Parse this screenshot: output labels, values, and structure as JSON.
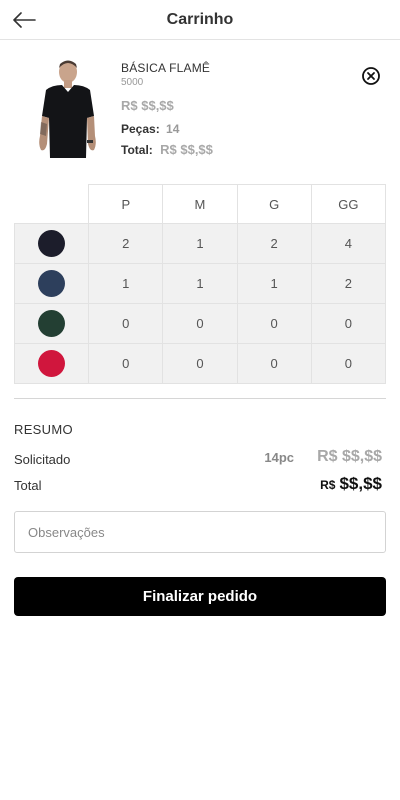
{
  "header": {
    "title": "Carrinho",
    "back_icon": "arrow-left-icon"
  },
  "product": {
    "name": "BÁSICA FLAMÊ",
    "code": "5000",
    "price": "R$ $$,$$",
    "qty_label": "Peças:",
    "qty_value": "14",
    "total_label": "Total:",
    "total_value": "R$ $$,$$",
    "remove_icon": "close-circle-icon"
  },
  "grid": {
    "sizes": [
      "P",
      "M",
      "G",
      "GG"
    ],
    "rows": [
      {
        "color": "#1c1d2b",
        "values": [
          "2",
          "1",
          "2",
          "4"
        ]
      },
      {
        "color": "#2d3f5c",
        "values": [
          "1",
          "1",
          "1",
          "2"
        ]
      },
      {
        "color": "#233f33",
        "values": [
          "0",
          "0",
          "0",
          "0"
        ]
      },
      {
        "color": "#d0163d",
        "values": [
          "0",
          "0",
          "0",
          "0"
        ]
      }
    ]
  },
  "summary": {
    "title": "RESUMO",
    "requested_label": "Solicitado",
    "requested_pieces": "14pc",
    "requested_value": "R$ $$,$$",
    "total_label": "Total",
    "total_currency": "R$",
    "total_value": "$$,$$"
  },
  "observations": {
    "placeholder": "Observações",
    "value": ""
  },
  "submit": {
    "label": "Finalizar pedido"
  }
}
